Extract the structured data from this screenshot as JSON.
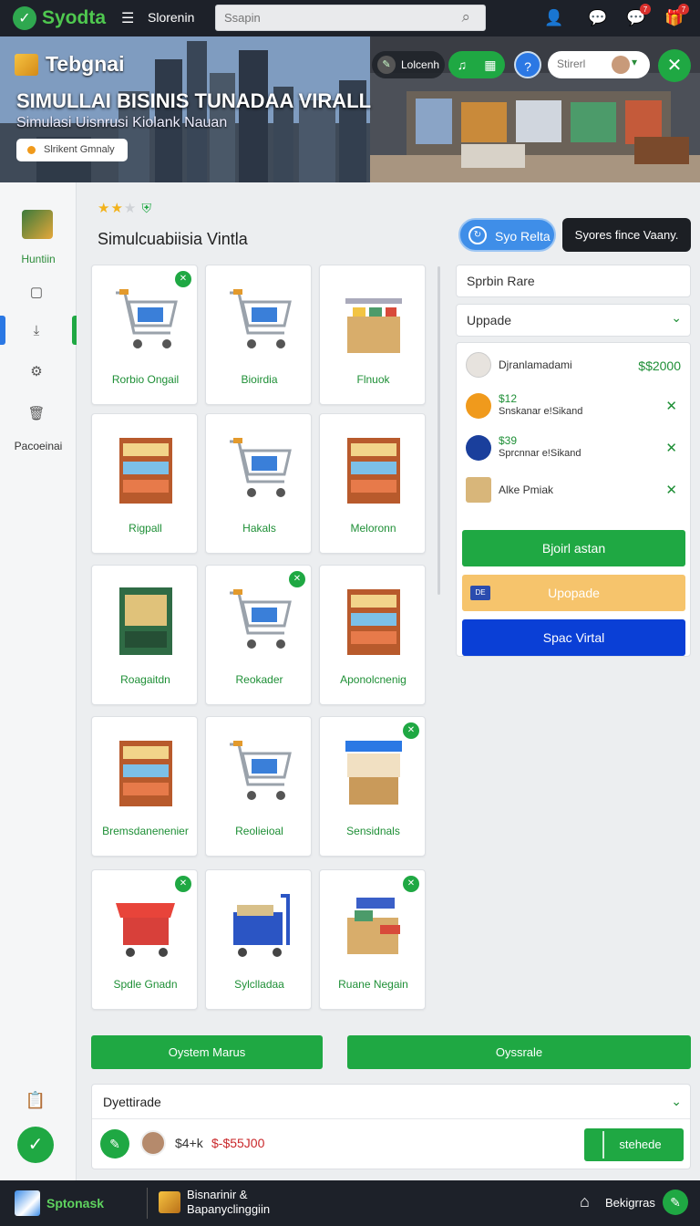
{
  "topbar": {
    "brand": "Syodta",
    "menu_label": "Slorenin",
    "search_placeholder": "Ssapin",
    "notification_badges": [
      "7",
      "7"
    ]
  },
  "hero": {
    "brand": "Tebgnai",
    "title": "SIMULLAI BISINIS TUNADAA VIRALL",
    "subtitle": "Simulasi Uisnrusi Kiolank Nauan",
    "chip": "Slrikent Gmnaly",
    "controls": {
      "dark_pill": "Lolcenh",
      "search_placeholder": "Stirerl"
    }
  },
  "sidebar": {
    "home_label": "Huntiin",
    "tools_label": "Pacoeinai"
  },
  "main": {
    "rating": {
      "value": 2,
      "max": 3
    },
    "title": "Simulcuabiisia Vintla",
    "btn_pill": "Syo Relta",
    "btn_dark": "Syores fince Vaany.",
    "products": [
      {
        "label": "Rorbio Ongail",
        "image": "shopping-cart-icon",
        "marked": true
      },
      {
        "label": "Bioirdia",
        "image": "shopping-cart-icon",
        "marked": false
      },
      {
        "label": "Flnuok",
        "image": "display-table-icon",
        "marked": false
      },
      {
        "label": "Rigpall",
        "image": "shelf-icon",
        "marked": false
      },
      {
        "label": "Hakals",
        "image": "shopping-cart-icon",
        "marked": false
      },
      {
        "label": "Meloronn",
        "image": "shelf-icon",
        "marked": false
      },
      {
        "label": "Roagaitdn",
        "image": "cabinet-icon",
        "marked": false
      },
      {
        "label": "Reokader",
        "image": "shopping-cart-icon",
        "marked": true
      },
      {
        "label": "Aponolcnenig",
        "image": "shelf-icon",
        "marked": false
      },
      {
        "label": "Bremsdanenenier",
        "image": "shelf-icon",
        "marked": false
      },
      {
        "label": "Reolieioal",
        "image": "shopping-cart-icon",
        "marked": false
      },
      {
        "label": "Sensidnals",
        "image": "kiosk-icon",
        "marked": true
      },
      {
        "label": "Spdle Gnadn",
        "image": "market-stall-icon",
        "marked": true
      },
      {
        "label": "Sylclladaa",
        "image": "utility-cart-icon",
        "marked": false
      },
      {
        "label": "Ruane Negain",
        "image": "crate-icon",
        "marked": true
      }
    ]
  },
  "panel": {
    "field1": "Sprbin Rare",
    "field2": "Uppade",
    "rows": [
      {
        "name": "Djranlamadami",
        "price": "$$2000"
      },
      {
        "price": "$12",
        "desc": "Snskanar e!Sikand"
      },
      {
        "price": "$39",
        "desc": "Sprcnnar e!Sikand"
      },
      {
        "name": "Alke Pmiak"
      }
    ],
    "btn_green": "Bjoirl astan",
    "btn_orange": "Upopade",
    "btn_orange_tag": "DE",
    "btn_blue": "Spac Virtal"
  },
  "actions": {
    "left": "Oystem Marus",
    "right": "Oyssrale"
  },
  "summary": {
    "title": "Dyettirade",
    "value1": "$4+k",
    "value2": "$-$55J00",
    "save": "stehede"
  },
  "bottombar": {
    "app": "Sptonask",
    "line1": "Bisnarinir &",
    "line2": "Bapanyclinggiin",
    "right_label": "Bekigrras"
  }
}
